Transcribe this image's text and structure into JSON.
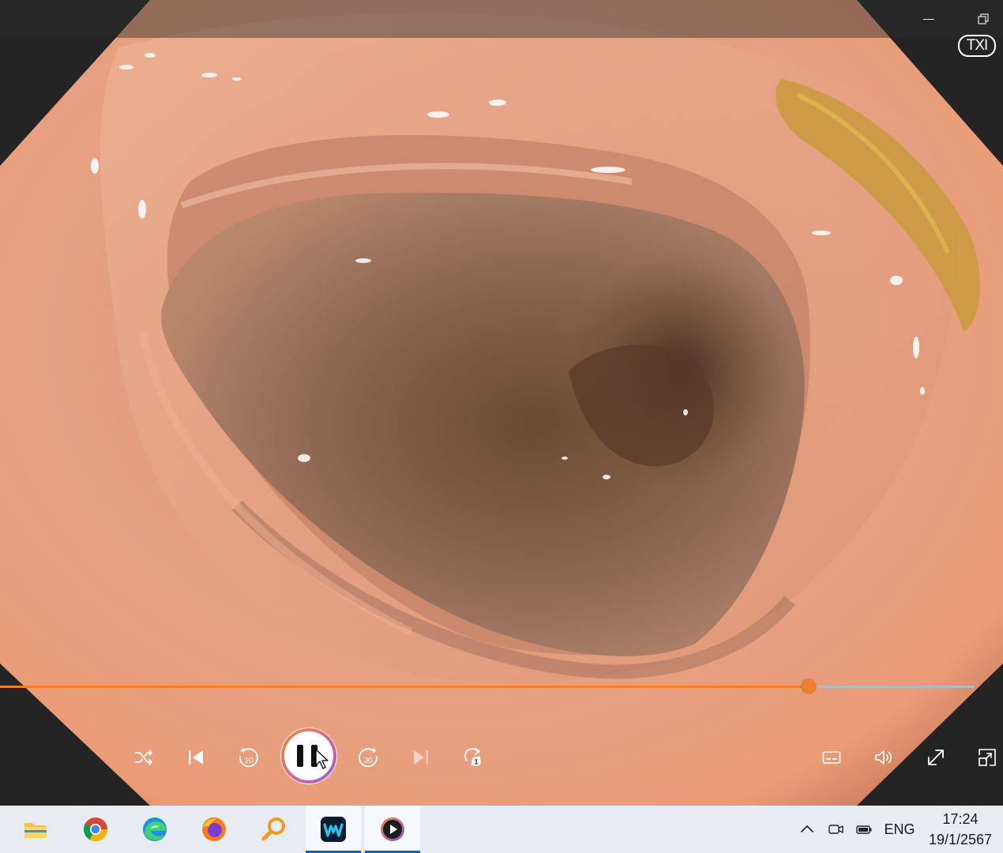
{
  "window": {
    "minimize_label": "Minimize",
    "restore_label": "Restore"
  },
  "video": {
    "overlay_mark": "TXI"
  },
  "player": {
    "seek_progress": 0.83,
    "playing": true,
    "accent": "#f07f2c",
    "controls": {
      "shuffle": "shuffle-icon",
      "previous": "previous-track-icon",
      "skip_back": "skip-back-10-icon",
      "play_pause": "pause-icon",
      "skip_forward": "skip-forward-30-icon",
      "next": "next-track-icon",
      "repeat": "repeat-one-icon",
      "captions": "captions-icon",
      "volume": "volume-icon",
      "fullscreen": "fullscreen-icon",
      "mini_view": "mini-view-icon"
    },
    "skip_back_seconds": "10",
    "skip_forward_seconds": "30",
    "repeat_count": "1"
  },
  "taskbar": {
    "apps": [
      {
        "name": "file-explorer-icon",
        "active": false
      },
      {
        "name": "chrome-icon",
        "active": false
      },
      {
        "name": "edge-icon",
        "active": false
      },
      {
        "name": "firefox-icon",
        "active": false
      },
      {
        "name": "search-magnifier-app-icon",
        "active": false
      },
      {
        "name": "webex-icon",
        "active": true
      },
      {
        "name": "media-player-icon",
        "active": true
      }
    ],
    "tray": {
      "language": "ENG"
    },
    "clock": {
      "time": "17:24",
      "date": "19/1/2567"
    }
  }
}
